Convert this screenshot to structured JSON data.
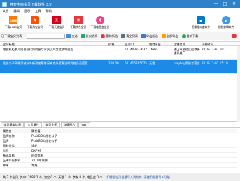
{
  "window": {
    "title": "神奇电商宝贝下载软件 3.0",
    "min": "—",
    "max": "□",
    "close": "✕"
  },
  "menu": [
    "文件",
    "编辑",
    "显示",
    "工具",
    "帮助"
  ],
  "toolbar": {
    "buttons": [
      {
        "label": "下载1688宝贝",
        "badge": "1688",
        "color": "#ff7a00"
      },
      {
        "label": "下载淘宝宝贝",
        "badge": "淘",
        "color": "#ff5000"
      },
      {
        "label": "下载天猫宝贝",
        "badge": "天",
        "color": "#d7001b"
      },
      {
        "label": "下载京东宝贝",
        "badge": "京",
        "color": "#e4393c"
      },
      {
        "label": "下载唯品会宝贝",
        "badge": "唯",
        "color": "#f33f8b"
      }
    ],
    "right_buttons": [
      {
        "label": "图像相似度软件",
        "color": "#007acc"
      },
      {
        "label": "视频剪辑软件",
        "color": "#3b9aea"
      }
    ]
  },
  "toolbar2": {
    "search_placeholder": "",
    "items": [
      "已下载宝贝列表",
      "全选",
      "反向选择",
      "删除所选",
      "清空列表",
      "导出所选",
      "全部导出",
      "重新下载"
    ]
  },
  "grid": {
    "headers": [
      "宝贝标题",
      "价格",
      "宝贝ID",
      "电商平台",
      "店铺名称",
      "下载时间"
    ],
    "rows": [
      {
        "title": "电视机柜茶几组合现代简约客厅家具小户型北欧电视柜",
        "price": "",
        "id": "521403323632",
        "platform": "1688",
        "shop": "佛山市顺德区伦教街镇家具厂",
        "time": "2019-12-07 19:11"
      },
      {
        "title": "花花公子高端男装秋冬新款加厚休闲夹克外套潮流时尚修身百搭款",
        "price": "269.00",
        "id": "601415285075",
        "platform": "天猫",
        "shop": "playboy男装专营店",
        "time": "2019-12-07 15:18"
      }
    ]
  },
  "tabs": [
    "宝贝基本信息",
    "宝贝属性",
    "宝贝主图",
    "详情图片",
    "SKU"
  ],
  "props": {
    "header": [
      "属性名",
      "属性值"
    ],
    "rows": [
      {
        "n": "品牌名称",
        "v": "PLAYBOY/花花公子"
      },
      {
        "n": "品牌",
        "v": "PLAYBOY/花花公子"
      },
      {
        "n": "面料分类",
        "v": "涤纶"
      },
      {
        "n": "货号",
        "v": "DXF99"
      },
      {
        "n": "基础风格",
        "v": "时尚都市"
      },
      {
        "n": "上市年份季节",
        "v": "2019年秋季"
      },
      {
        "n": "厚薄",
        "v": "常规"
      }
    ]
  },
  "status": {
    "left": "共 2 个宝贝, 其中: 1688 1 个, 淘宝 0 个, 天猫 1 个, 京东 0 个, 唯品会 0 个",
    "right": "如需把宝贝批量导入到软件, 请使用批量导入功能"
  }
}
